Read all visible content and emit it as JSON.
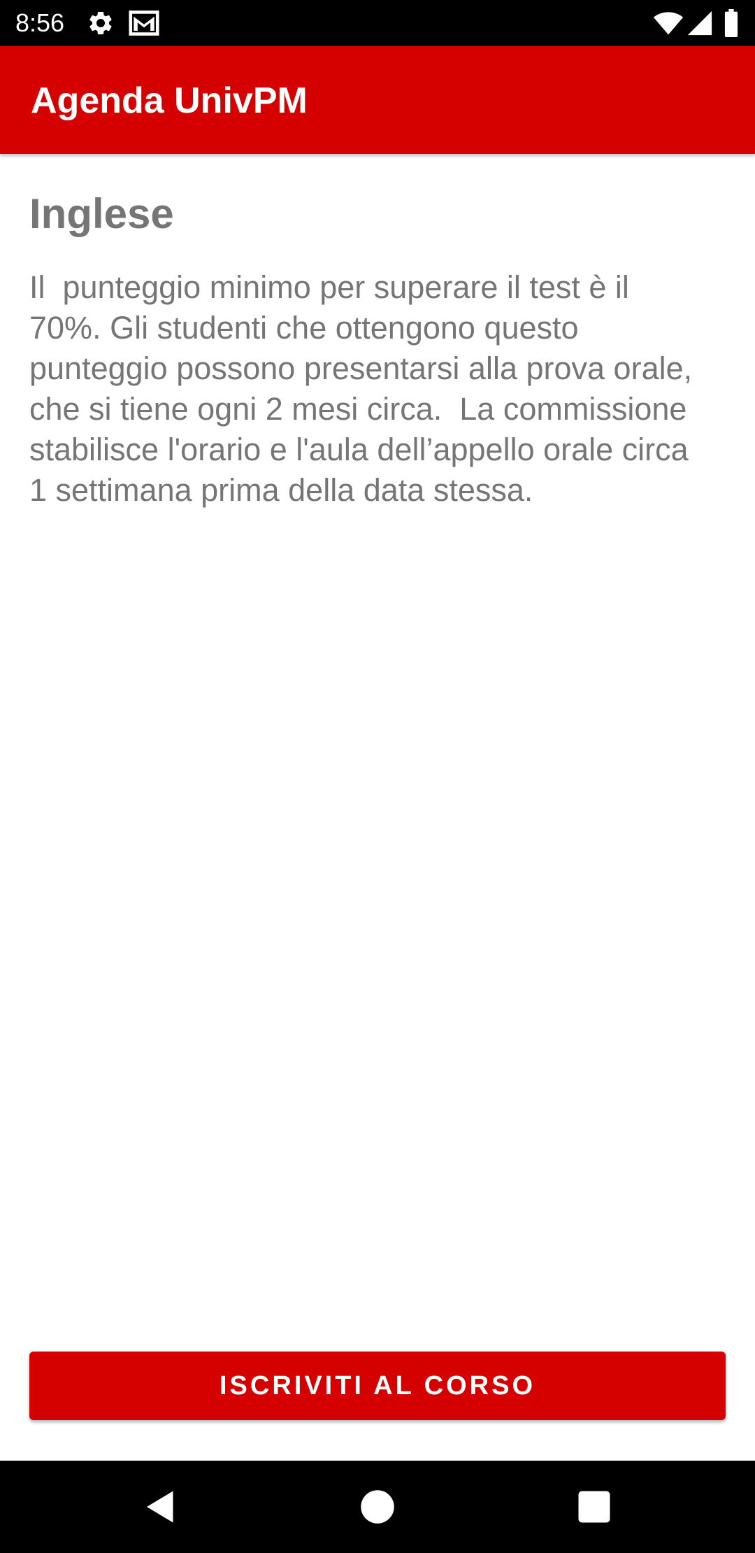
{
  "status_bar": {
    "time": "8:56",
    "icons": [
      "settings-icon",
      "gmail-icon",
      "wifi-icon",
      "signal-icon",
      "battery-icon"
    ]
  },
  "app_bar": {
    "title": "Agenda UnivPM",
    "color": "#d50000"
  },
  "course": {
    "title": "Inglese",
    "description": "Il  punteggio minimo per superare il test è il 70%. Gli studenti che ottengono questo punteggio possono presentarsi alla prova orale, che si tiene ogni 2 mesi circa.  La commissione stabilisce l'orario e l'aula dell’appello orale circa 1 settimana prima della data stessa."
  },
  "actions": {
    "enroll_label": "ISCRIVITI AL CORSO"
  },
  "nav_bar": {
    "icons": [
      "back-icon",
      "home-icon",
      "recents-icon"
    ]
  }
}
